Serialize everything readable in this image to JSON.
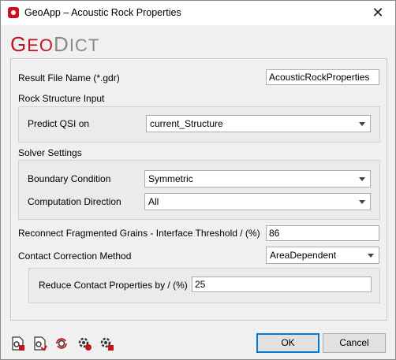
{
  "window": {
    "title": "GeoApp – Acoustic Rock Properties",
    "close_glyph": "✕"
  },
  "logo": {
    "geo_G": "G",
    "geo_rest": "EO",
    "dict_D": "D",
    "dict_rest": "ICT"
  },
  "result_file": {
    "label": "Result File Name (*.gdr)",
    "value": "AcousticRockProperties"
  },
  "rock_structure": {
    "heading": "Rock Structure Input",
    "predict_label": "Predict QSI on",
    "predict_value": "current_Structure"
  },
  "solver": {
    "heading": "Solver Settings",
    "boundary_label": "Boundary Condition",
    "boundary_value": "Symmetric",
    "direction_label": "Computation Direction",
    "direction_value": "All"
  },
  "reconnect": {
    "label": "Reconnect Fragmented Grains - Interface Threshold / (%)",
    "value": "86"
  },
  "contact": {
    "label": "Contact Correction Method",
    "value": "AreaDependent",
    "reduce_label": "Reduce Contact Properties by / (%)",
    "reduce_value": "25"
  },
  "buttons": {
    "ok": "OK",
    "cancel": "Cancel"
  },
  "toolbar_icons": [
    "load-settings-icon",
    "save-settings-icon",
    "reset-settings-icon",
    "macro-record-icon",
    "macro-stop-icon"
  ],
  "colors": {
    "brand_red": "#c0141e",
    "accent_blue": "#0078d7"
  }
}
